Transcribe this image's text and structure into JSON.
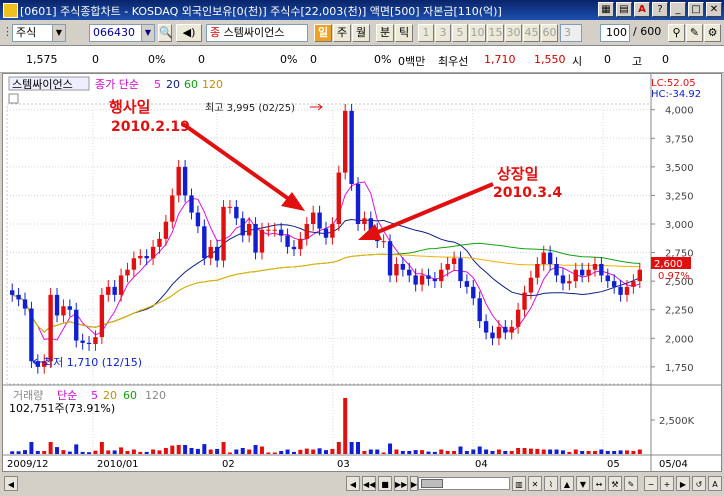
{
  "titlebar": {
    "title": "[0601] 주식종합차트 - KOSDAQ 외국인보유[0(천)] 주식수[22,003(천)] 액면[500] 자본금[110(억)]"
  },
  "toolbar": {
    "market_label": "주식",
    "code_value": "066430",
    "stock_name": "스템싸이언스",
    "period_buttons": [
      "일",
      "주",
      "월",
      "분",
      "틱"
    ],
    "minute_buttons": [
      "1",
      "3",
      "5",
      "10",
      "15",
      "30",
      "45",
      "60",
      "3"
    ],
    "count_value": "100",
    "count_total": "/ 600"
  },
  "infobar": {
    "price": "1,575",
    "v1": "0",
    "p1": "0%",
    "v2": "0",
    "p2": "0%",
    "v3": "0",
    "p3": "0%",
    "volume": "0백만",
    "best_offer_label": "최우선",
    "ask": "1,710",
    "bid": "1,550",
    "time_label": "시",
    "time_val": "0",
    "high_label": "고",
    "high_val": "0"
  },
  "chart": {
    "legend_name": "스템싸이언스",
    "legend_type": "종가 단순",
    "ma_labels": [
      "5",
      "20",
      "60",
      "120"
    ],
    "lc": "LC:52.05",
    "hc": "HC:-34.92",
    "high_annot": "최고 3,995 (02/25)",
    "low_annot": "최저 1,710 (12/15)",
    "event1_title": "행사일",
    "event1_date": "2010.2.19",
    "event2_title": "상장일",
    "event2_date": "2010.3.4",
    "current_price": "2,600",
    "current_pct": "0.97%",
    "vol_legend_name": "거래량",
    "vol_legend_type": "단순",
    "vol_ma_labels": [
      "5",
      "20",
      "60",
      "120"
    ],
    "vol_value": "102,751주(73.91%)",
    "vol_tick": "2,500K",
    "x_labels": [
      "2009/12",
      "2010/01",
      "02",
      "03",
      "04",
      "05",
      "05/04"
    ]
  },
  "colors": {
    "up": "#e01010",
    "down": "#1020d0",
    "ma5": "#e010e0",
    "ma20": "#102080",
    "ma60": "#10a010",
    "ma120": "#f0b000"
  },
  "chart_data": {
    "type": "candlestick",
    "title": "스템싸이언스",
    "y_ticks": [
      1750,
      2000,
      2250,
      2500,
      2750,
      3000,
      3250,
      3500,
      3750,
      4000
    ],
    "ylim": [
      1600,
      4050
    ],
    "x_ticks": [
      "2009/12",
      "2010/01",
      "02",
      "03",
      "04",
      "05",
      "05/04"
    ],
    "series": [
      {
        "name": "종가",
        "values": [
          2380,
          2340,
          2260,
          1800,
          1750,
          1800,
          2380,
          2200,
          2280,
          2250,
          1980,
          1960,
          1950,
          2010,
          2380,
          2450,
          2380,
          2550,
          2600,
          2700,
          2720,
          2700,
          2800,
          2870,
          3020,
          3250,
          3500,
          3250,
          3100,
          2980,
          2700,
          2800,
          2680,
          3150,
          3150,
          3050,
          2900,
          3000,
          2750,
          2950,
          2950,
          2950,
          2900,
          2800,
          2780,
          2870,
          3000,
          3100,
          2960,
          2880,
          3000,
          3450,
          3990,
          3350,
          3000,
          3050,
          2950,
          2850,
          2850,
          2550,
          2650,
          2600,
          2550,
          2470,
          2550,
          2520,
          2500,
          2600,
          2650,
          2700,
          2500,
          2450,
          2350,
          2150,
          2050,
          2000,
          2100,
          2050,
          2100,
          2250,
          2400,
          2530,
          2650,
          2750,
          2650,
          2550,
          2480,
          2500,
          2600,
          2550,
          2600,
          2650,
          2550,
          2500,
          2450,
          2380,
          2450,
          2500,
          2600
        ]
      },
      {
        "name": "5",
        "values": []
      },
      {
        "name": "20",
        "values": []
      },
      {
        "name": "60",
        "values": []
      },
      {
        "name": "120",
        "values": []
      }
    ],
    "volume_ylabel": "거래량",
    "volume_tick": "2,500K"
  }
}
